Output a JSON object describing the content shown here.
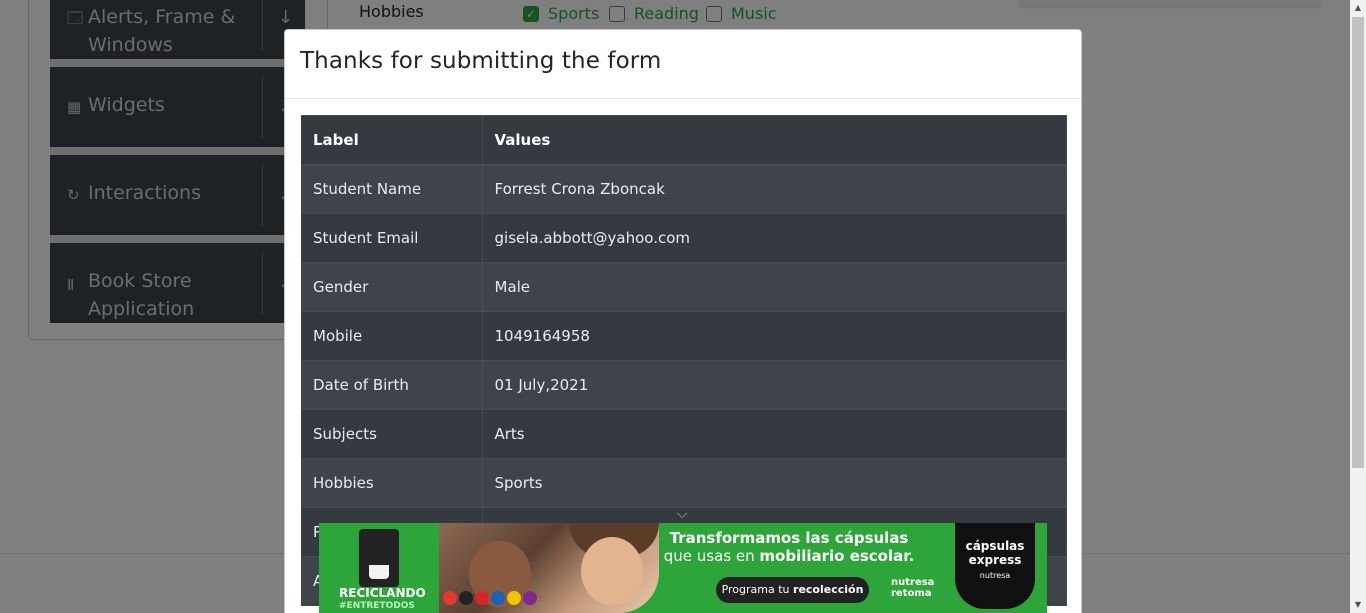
{
  "background": {
    "sidebar": [
      {
        "label": "Alerts, Frame &",
        "label2": "Windows",
        "icon": "window-icon"
      },
      {
        "label": "Widgets",
        "label2": "",
        "icon": "widgets-icon"
      },
      {
        "label": "Interactions",
        "label2": "",
        "icon": "interactions-icon"
      },
      {
        "label": "Book Store",
        "label2": "Application",
        "icon": "books-icon"
      }
    ],
    "hobbies_label": "Hobbies",
    "hobbies": [
      {
        "label": "Sports",
        "checked": true
      },
      {
        "label": "Reading",
        "checked": false
      },
      {
        "label": "Music",
        "checked": false
      }
    ]
  },
  "modal": {
    "title": "Thanks for submitting the form",
    "table": {
      "headers": [
        "Label",
        "Values"
      ],
      "rows": [
        {
          "label": "Student Name",
          "value": "Forrest Crona Zboncak"
        },
        {
          "label": "Student Email",
          "value": "gisela.abbott@yahoo.com"
        },
        {
          "label": "Gender",
          "value": "Male"
        },
        {
          "label": "Mobile",
          "value": "1049164958"
        },
        {
          "label": "Date of Birth",
          "value": "01 July,2021"
        },
        {
          "label": "Subjects",
          "value": "Arts"
        },
        {
          "label": "Hobbies",
          "value": "Sports"
        },
        {
          "label": "P",
          "value": ""
        },
        {
          "label": "A",
          "value": ""
        }
      ]
    }
  },
  "ad": {
    "headline_line1": "Transformamos las cápsulas",
    "headline_line2a": "que usas en ",
    "headline_line2b": "mobiliario escolar.",
    "cta_prefix": "Programa tu ",
    "cta_bold": "recolección",
    "left_text1": "RECICLANDO",
    "left_text2": "#ENTRETODOS",
    "brand1": "cápsulas",
    "brand2": "express",
    "brand3": "nutresa",
    "nutresa_text1": "nutresa",
    "nutresa_text2": "retoma",
    "colors": {
      "green": "#2da53a",
      "black": "#111111"
    }
  }
}
